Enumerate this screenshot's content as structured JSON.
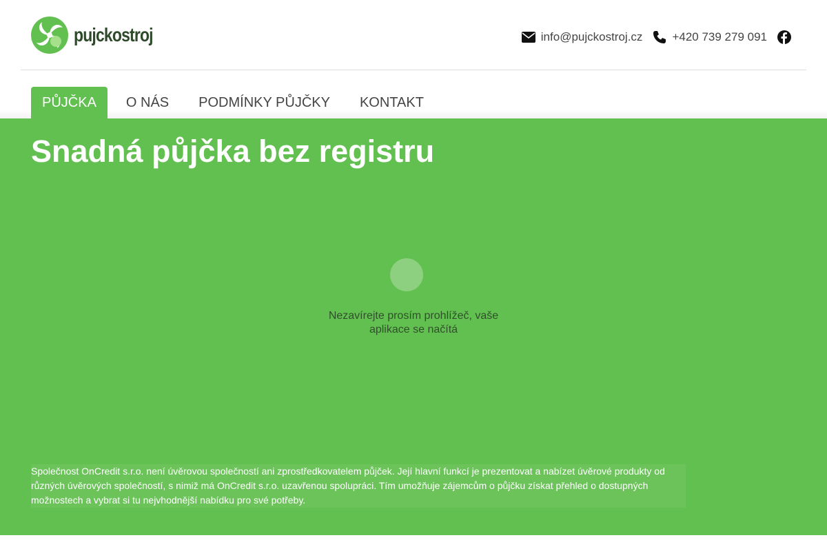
{
  "header": {
    "logo_text": "pujckostroj",
    "email": "info@pujckostroj.cz",
    "phone": "+420 739 279 091"
  },
  "nav": {
    "items": [
      {
        "label": "PŮJČKA",
        "active": true
      },
      {
        "label": "O NÁS",
        "active": false
      },
      {
        "label": "PODMÍNKY PŮJČKY",
        "active": false
      },
      {
        "label": "KONTAKT",
        "active": false
      }
    ]
  },
  "hero": {
    "title": "Snadná půjčka bez registru",
    "loading_text": "Nezavírejte prosím prohlížeč, vaše aplikace se načítá",
    "disclaimer": "Společnost OnCredit s.r.o. není úvěrovou společností ani zprostředkovatelem půjček. Její hlavní funkcí je prezentovat a nabízet úvěrové produkty od různých úvěrových společností, s nimiž má OnCredit s.r.o. uzavřenou spolupráci. Tím umožňuje zájemcům o půjčku získat přehled o dostupných možnostech a vybrat si tu nejvhodnější nabídku pro své potřeby."
  },
  "colors": {
    "brand_green": "#62c050",
    "logo_dark": "#2e4a2a",
    "logo_light": "#a6e08a"
  },
  "icons": [
    "logo-icon",
    "envelope-icon",
    "phone-icon",
    "facebook-icon",
    "loading-spinner"
  ]
}
